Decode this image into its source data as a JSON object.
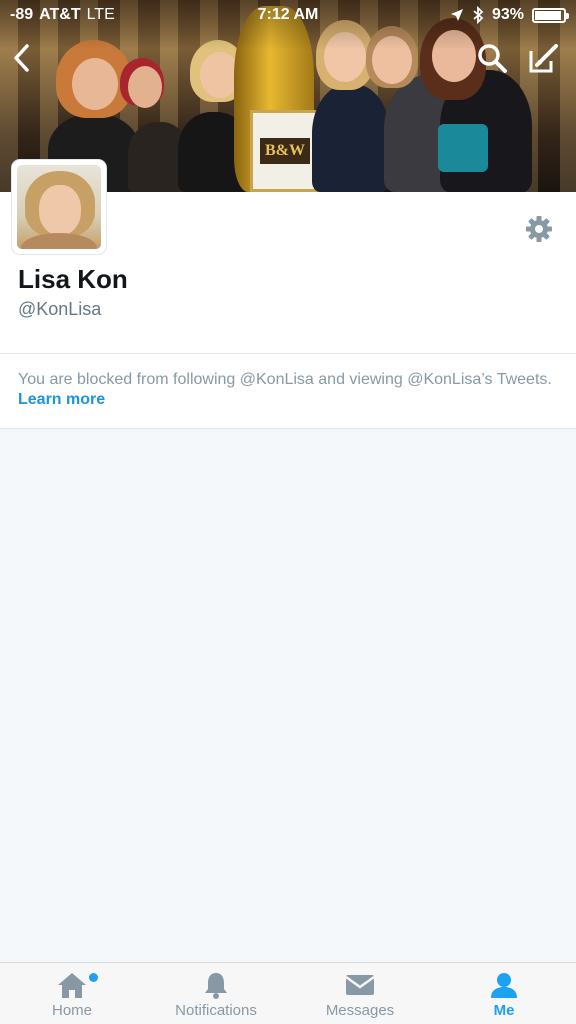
{
  "status_bar": {
    "signal": "-89",
    "carrier": "AT&T",
    "network": "LTE",
    "time": "7:12 AM",
    "battery_percent": "93%",
    "battery_level": 0.93
  },
  "header": {
    "back_icon": "chevron-left-icon",
    "search_icon": "search-icon",
    "compose_icon": "compose-icon",
    "banner_sign_text": "B&W"
  },
  "profile": {
    "name": "Lisa Kon",
    "handle": "@KonLisa",
    "settings_icon": "gear-icon"
  },
  "notice": {
    "text": "You are blocked from following @KonLisa and viewing @KonLisa’s Tweets.",
    "link": "Learn more"
  },
  "tabbar": {
    "items": [
      {
        "label": "Home",
        "icon": "home-icon",
        "has_badge": true
      },
      {
        "label": "Notifications",
        "icon": "bell-icon"
      },
      {
        "label": "Messages",
        "icon": "envelope-icon"
      },
      {
        "label": "Me",
        "icon": "person-icon",
        "active": true
      }
    ]
  },
  "colors": {
    "accent": "#1da1f2",
    "muted": "#8899a6",
    "text": "#14171a"
  }
}
